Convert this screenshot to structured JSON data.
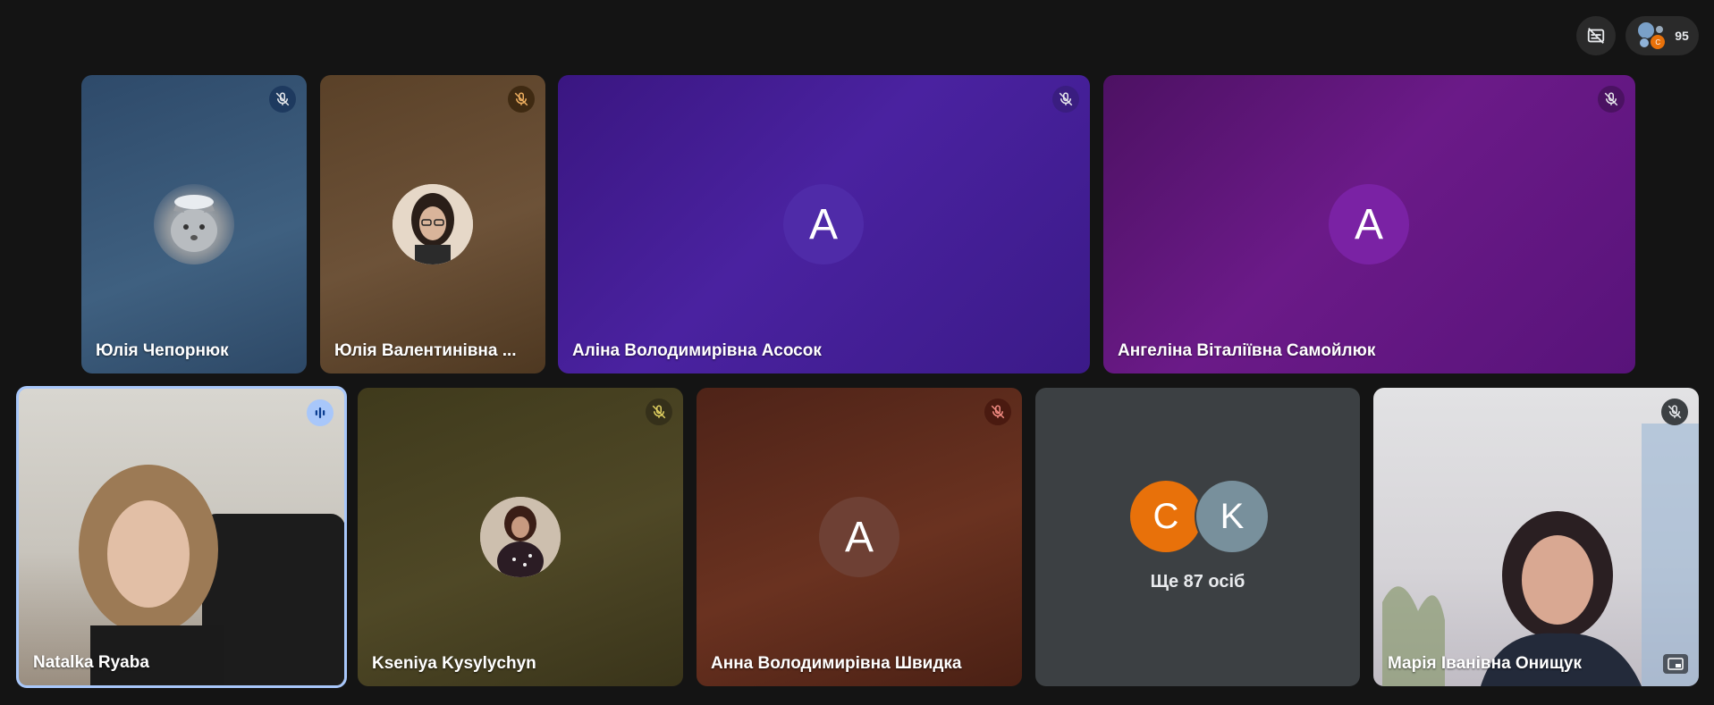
{
  "topbar": {
    "captions_icon": "captions-off-icon",
    "people_count": "95",
    "people_avatar_letter": "C"
  },
  "tiles": [
    {
      "name": "Юлія Чепорнюк",
      "muted": true,
      "kind": "photo",
      "photo": "lynx"
    },
    {
      "name": "Юлія Валентинівна ...",
      "muted": true,
      "kind": "photo",
      "photo": "woman-glasses"
    },
    {
      "name": "Аліна Володимирівна Асосок",
      "muted": true,
      "kind": "letter",
      "letter": "А"
    },
    {
      "name": "Ангеліна Віталіївна Самойлюк",
      "muted": true,
      "kind": "letter",
      "letter": "А"
    },
    {
      "name": "Natalka Ryaba",
      "muted": false,
      "speaking": true,
      "kind": "video"
    },
    {
      "name": "Kseniya Kysylychyn",
      "muted": true,
      "kind": "photo",
      "photo": "woman-phone"
    },
    {
      "name": "Анна Володимирівна Швидка",
      "muted": true,
      "kind": "letter",
      "letter": "А"
    },
    {
      "name": "",
      "kind": "overflow",
      "letters": [
        "С",
        "K"
      ],
      "label": "Ще 87 осіб"
    },
    {
      "name": "Марія Іванівна Онищук",
      "muted": true,
      "kind": "video"
    }
  ],
  "colors": {
    "background": "#141414",
    "speaking_outline": "#a8c7fa",
    "overflow_c": "#e8710a",
    "overflow_k": "#78909c"
  }
}
